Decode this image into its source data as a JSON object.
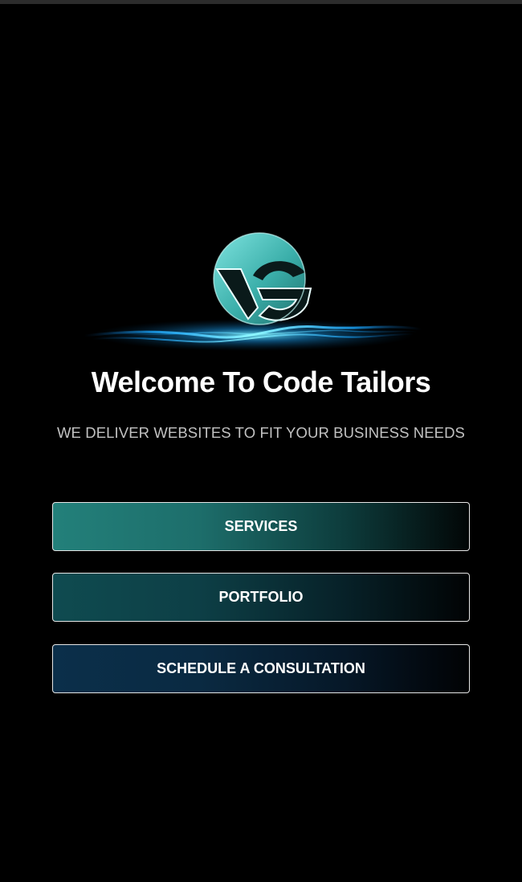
{
  "brand": {
    "logo_icon": "code-tailors-cg-monogram-logo",
    "accent_color": "#3fd0c9",
    "wave_color": "#1aa7ff"
  },
  "hero": {
    "title": "Welcome To Code Tailors",
    "tagline": "WE DELIVER WEBSITES TO FIT YOUR BUSINESS NEEDS"
  },
  "nav_buttons": [
    {
      "label": "SERVICES",
      "color": "#23807a"
    },
    {
      "label": "PORTFOLIO",
      "color": "#0f4b50"
    },
    {
      "label": "SCHEDULE A CONSULTATION",
      "color": "#0b2f4a"
    }
  ]
}
